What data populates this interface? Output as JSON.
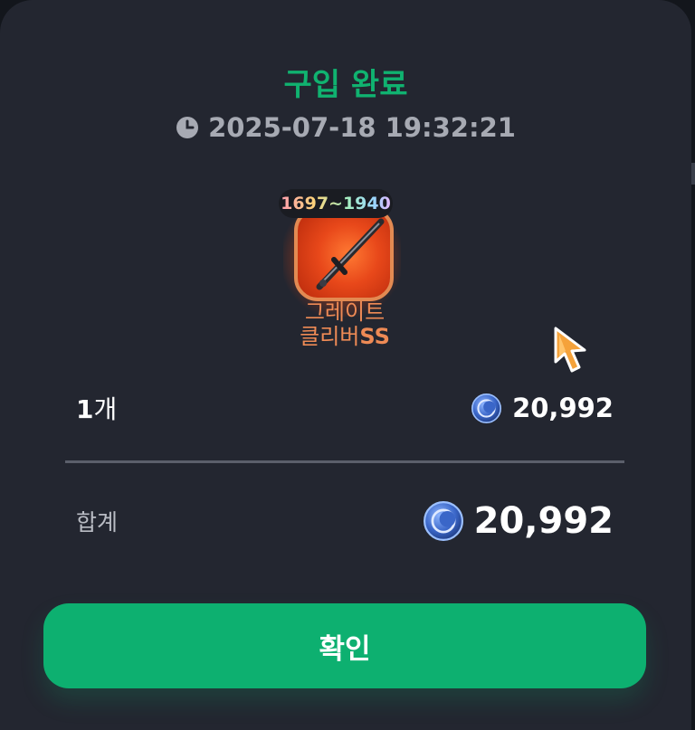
{
  "dialog": {
    "title": "구입 완료",
    "timestamp": "2025-07-18 19:32:21",
    "icons": {
      "clock": "clock-icon",
      "coin": "coin-icon",
      "cursor": "pointer-cursor-icon",
      "item": "sword-icon"
    }
  },
  "item": {
    "range": "1697~1940",
    "name_line1": "그레이트",
    "name_line2": "클리버",
    "grade": "SS",
    "colors": {
      "name": "#ee8a55",
      "frame": "#e38a52"
    }
  },
  "purchase": {
    "quantity_number": "1",
    "quantity_unit": "개",
    "unit_price": "20,992",
    "total_label": "합계",
    "total_price": "20,992"
  },
  "actions": {
    "confirm_label": "확인"
  },
  "colors": {
    "accent": "#10b270",
    "button": "#0db070",
    "dialog_bg": "#232630"
  }
}
